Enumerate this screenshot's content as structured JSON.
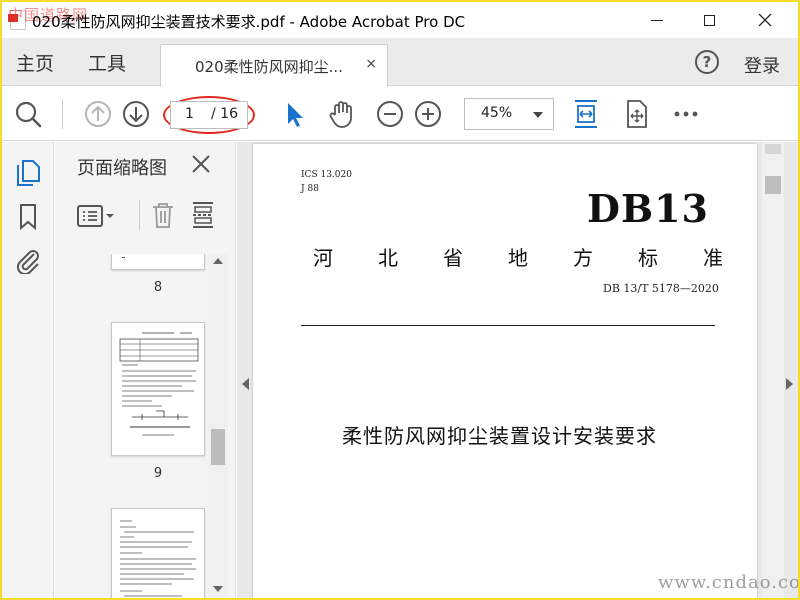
{
  "window": {
    "title": "020柔性防风网抑尘装置技术要求.pdf - Adobe Acrobat Pro DC",
    "watermark_top": "中国道路网",
    "watermark_bottom": "www.cndao.com"
  },
  "tabs": {
    "home": "主页",
    "tools": "工具",
    "document": "020柔性防风网抑尘...",
    "close": "×",
    "help": "?",
    "login": "登录"
  },
  "toolbar": {
    "page_current": "1",
    "page_total": "/ 16",
    "zoom": "45%"
  },
  "thumbnails": {
    "title": "页面缩略图",
    "pages": [
      {
        "label": "8"
      },
      {
        "label": "9"
      }
    ]
  },
  "document": {
    "ics": "ICS 13.020",
    "class_code": "J 88",
    "std_prefix": "DB13",
    "province_chars": [
      "河",
      "北",
      "省",
      "地",
      "方",
      "标",
      "准"
    ],
    "std_number": "DB 13/T 5178—2020",
    "title": "柔性防风网抑尘装置设计安装要求"
  },
  "colors": {
    "accent": "#1a73c8",
    "highlight": "#e02b20",
    "frame": "#f2dd2a"
  }
}
